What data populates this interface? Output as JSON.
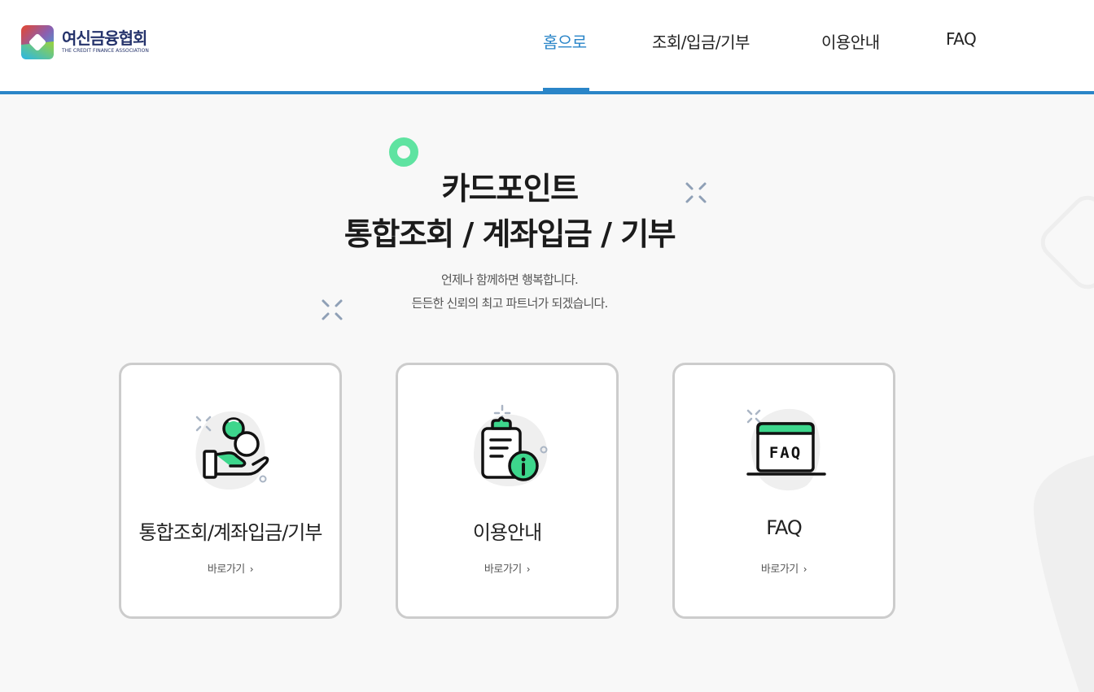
{
  "header": {
    "logo": {
      "name_ko": "여신금융협회",
      "name_en": "THE CREDIT FINANCE ASSOCIATION"
    },
    "nav": [
      {
        "label": "홈으로",
        "active": true
      },
      {
        "label": "조회/입금/기부",
        "active": false
      },
      {
        "label": "이용안내",
        "active": false
      },
      {
        "label": "FAQ",
        "active": false
      }
    ]
  },
  "hero": {
    "title_line1": "카드포인트",
    "title_line2": "통합조회 / 계좌입금 / 기부",
    "subtitle_line1": "언제나 함께하면 행복합니다.",
    "subtitle_line2": "든든한 신뢰의 최고 파트너가 되겠습니다."
  },
  "cards": [
    {
      "title": "통합조회/계좌입금/기부",
      "link": "바로가기",
      "icon": "hand-coins-icon"
    },
    {
      "title": "이용안내",
      "link": "바로가기",
      "icon": "clipboard-info-icon"
    },
    {
      "title": "FAQ",
      "link": "바로가기",
      "icon": "faq-window-icon"
    }
  ],
  "colors": {
    "accent": "#2a85c8",
    "brand_navy": "#25336b",
    "icon_green": "#3dd68c",
    "card_border": "#cccccc"
  }
}
